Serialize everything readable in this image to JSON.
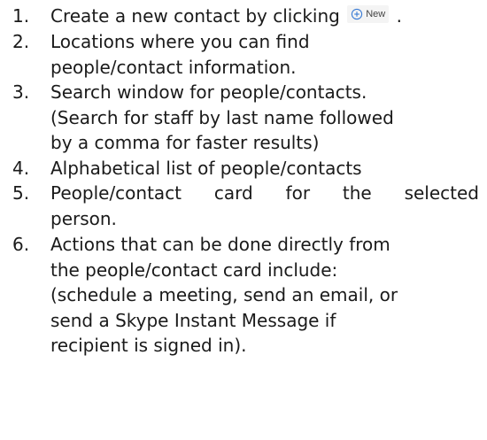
{
  "steps": [
    {
      "number": "1.",
      "lines": [
        "Create a new contact by clicking",
        "."
      ],
      "chip_label": "New"
    },
    {
      "number": "2.",
      "lines": [
        "Locations where you can find",
        "people/contact information."
      ]
    },
    {
      "number": "3.",
      "lines": [
        "Search window for people/contacts.",
        "(Search for staff by last name followed",
        "by a comma for faster results)"
      ]
    },
    {
      "number": "4.",
      "lines": [
        "Alphabetical list of people/contacts"
      ]
    },
    {
      "number": "5.",
      "lines": [
        "People/contact card for the selected",
        "person."
      ]
    },
    {
      "number": "6.",
      "lines": [
        "Actions that can be done directly from",
        "the people/contact card include:",
        "(schedule a meeting, send an email, or",
        "send a Skype Instant Message if",
        "recipient is signed in)."
      ]
    }
  ],
  "colors": {
    "text": "#1a1a1a",
    "chip_icon": "#3a7bd5"
  },
  "icons": {
    "new_chip": "plus-circle-icon"
  }
}
